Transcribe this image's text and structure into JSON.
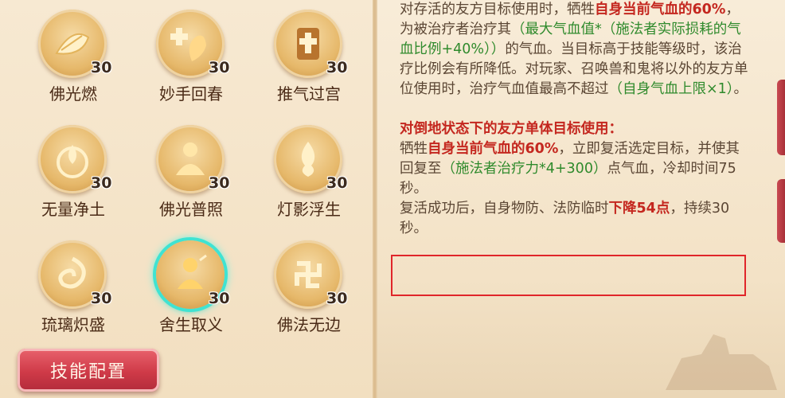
{
  "skills": [
    {
      "name": "佛光燃",
      "level": "30",
      "icon": "lotus-fire-icon"
    },
    {
      "name": "妙手回春",
      "level": "30",
      "icon": "healing-hand-icon"
    },
    {
      "name": "推气过宫",
      "level": "30",
      "icon": "cross-shrine-icon"
    },
    {
      "name": "无量净土",
      "level": "30",
      "icon": "flame-circle-icon"
    },
    {
      "name": "佛光普照",
      "level": "30",
      "icon": "buddha-meditate-icon"
    },
    {
      "name": "灯影浮生",
      "level": "30",
      "icon": "lamp-flame-icon"
    },
    {
      "name": "琉璃炽盛",
      "level": "30",
      "icon": "swirl-fire-icon"
    },
    {
      "name": "舍生取义",
      "level": "30",
      "icon": "sacrifice-monk-icon",
      "selected": true
    },
    {
      "name": "佛法无边",
      "level": "30",
      "icon": "swastika-icon"
    }
  ],
  "config_button": "技能配置",
  "description": {
    "p1": {
      "a": "对存活的友方目标使用时，牺牲",
      "b": "自身当前气血的60%",
      "c": "，为被治疗者治疗其",
      "d": "（最大气血值*（施法者实际损耗的气血比例+40%））",
      "e": "的气血。当目标高于技能等级时，该治疗比例会有所降低。对玩家、召唤兽和鬼将以外的友方单位使用时，治疗气血值最高不超过",
      "f": "（自身气血上限×1）",
      "g": "。"
    },
    "p2_title": "对倒地状态下的友方单体目标使用：",
    "p2": {
      "a": "牺牲",
      "b": "自身当前气血的60%",
      "c": "，立即复活选定目标，并使其回复至",
      "d": "（施法者治疗力*4+300）",
      "e": "点气血，冷却时间75秒。"
    },
    "p3": {
      "a": "复活成功后，自身物防、法防临时",
      "b": "下降54点",
      "c": "，持续30秒。"
    }
  },
  "colors": {
    "emphasis": "#c4271f",
    "formula": "#2f8a2c",
    "highlight_box": "#e0262a",
    "selected_ring": "#3fe3d2"
  }
}
